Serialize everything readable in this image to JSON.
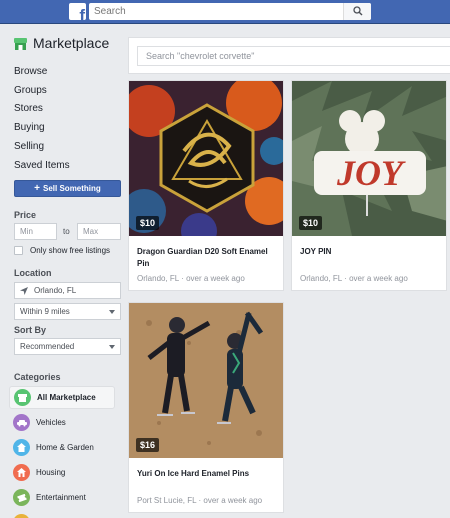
{
  "topbar": {
    "logo_letter": "f",
    "search_placeholder": "Search"
  },
  "sidebar": {
    "title": "Marketplace",
    "nav": [
      "Browse",
      "Groups",
      "Stores",
      "Buying",
      "Selling",
      "Saved Items"
    ],
    "sell_label": "Sell Something",
    "price": {
      "label": "Price",
      "min_placeholder": "Min",
      "to": "to",
      "max_placeholder": "Max",
      "free_label": "Only show free listings"
    },
    "location": {
      "label": "Location",
      "city": "Orlando, FL",
      "radius": "Within 9 miles"
    },
    "sort": {
      "label": "Sort By",
      "value": "Recommended"
    },
    "categories": {
      "label": "Categories",
      "items": [
        {
          "label": "All Marketplace",
          "color": "#58c472",
          "icon": "store-icon",
          "active": true
        },
        {
          "label": "Vehicles",
          "color": "#a275c9",
          "icon": "car-icon",
          "active": false
        },
        {
          "label": "Home & Garden",
          "color": "#50b5e8",
          "icon": "house-icon",
          "active": false
        },
        {
          "label": "Housing",
          "color": "#f06c4f",
          "icon": "building-icon",
          "active": false
        },
        {
          "label": "Entertainment",
          "color": "#7bb55b",
          "icon": "ticket-icon",
          "active": false
        }
      ]
    }
  },
  "main": {
    "search_placeholder": "Search \"chevrolet corvette\"",
    "listings": [
      {
        "price": "$10",
        "title": "Dragon Guardian D20 Soft Enamel Pin",
        "location": "Orlando, FL",
        "time": "over a week ago",
        "image": "dragon-d20-photo"
      },
      {
        "price": "$10",
        "title": "JOY PIN",
        "location": "Orlando, FL",
        "time": "over a week ago",
        "image": "joy-pin-photo"
      },
      {
        "price": "$16",
        "title": "Yuri On Ice Hard Enamel Pins",
        "location": "Port St Lucie, FL",
        "time": "over a week ago",
        "image": "skaters-pin-photo"
      }
    ]
  }
}
